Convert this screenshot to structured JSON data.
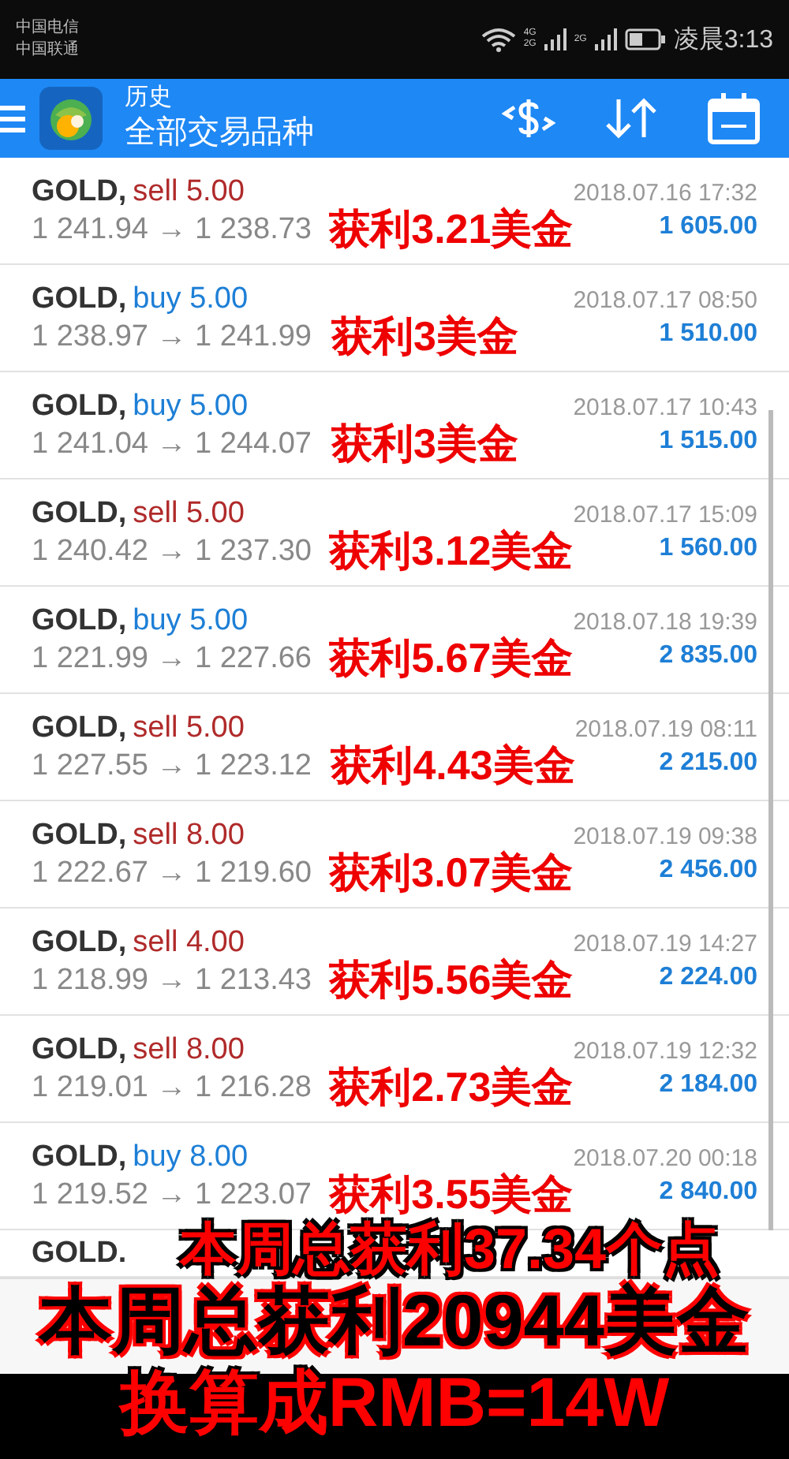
{
  "status_bar": {
    "carriers": [
      "中国电信",
      "中国联通"
    ],
    "network_labels": [
      "4G",
      "2G",
      "2G"
    ],
    "time": "凌晨3:13"
  },
  "app_bar": {
    "title": "历史",
    "subtitle": "全部交易品种"
  },
  "trades": [
    {
      "symbol": "GOLD,",
      "side": "sell",
      "lots": "5.00",
      "prices": "1 241.94 → 1 238.73",
      "time": "2018.07.16 17:32",
      "profit": "1 605.00",
      "note": "获利3.21美金"
    },
    {
      "symbol": "GOLD,",
      "side": "buy",
      "lots": "5.00",
      "prices": "1 238.97 → 1 241.99",
      "time": "2018.07.17 08:50",
      "profit": "1 510.00",
      "note": "获利3美金"
    },
    {
      "symbol": "GOLD,",
      "side": "buy",
      "lots": "5.00",
      "prices": "1 241.04 → 1 244.07",
      "time": "2018.07.17 10:43",
      "profit": "1 515.00",
      "note": "获利3美金"
    },
    {
      "symbol": "GOLD,",
      "side": "sell",
      "lots": "5.00",
      "prices": "1 240.42 → 1 237.30",
      "time": "2018.07.17 15:09",
      "profit": "1 560.00",
      "note": "获利3.12美金"
    },
    {
      "symbol": "GOLD,",
      "side": "buy",
      "lots": "5.00",
      "prices": "1 221.99 → 1 227.66",
      "time": "2018.07.18 19:39",
      "profit": "2 835.00",
      "note": "获利5.67美金"
    },
    {
      "symbol": "GOLD,",
      "side": "sell",
      "lots": "5.00",
      "prices": "1 227.55 → 1 223.12",
      "time": "2018.07.19 08:11",
      "profit": "2 215.00",
      "note": "获利4.43美金"
    },
    {
      "symbol": "GOLD,",
      "side": "sell",
      "lots": "8.00",
      "prices": "1 222.67 → 1 219.60",
      "time": "2018.07.19 09:38",
      "profit": "2 456.00",
      "note": "获利3.07美金"
    },
    {
      "symbol": "GOLD,",
      "side": "sell",
      "lots": "4.00",
      "prices": "1 218.99 → 1 213.43",
      "time": "2018.07.19 14:27",
      "profit": "2 224.00",
      "note": "获利5.56美金"
    },
    {
      "symbol": "GOLD,",
      "side": "sell",
      "lots": "8.00",
      "prices": "1 219.01 → 1 216.28",
      "time": "2018.07.19 12:32",
      "profit": "2 184.00",
      "note": "获利2.73美金"
    },
    {
      "symbol": "GOLD,",
      "side": "buy",
      "lots": "8.00",
      "prices": "1 219.52 → 1 223.07",
      "time": "2018.07.20 00:18",
      "profit": "2 840.00",
      "note": "获利3.55美金"
    }
  ],
  "partial_row": {
    "symbol": "GOLD."
  },
  "banners": [
    {
      "kind": "red",
      "text": "本周总获利37.34个点"
    },
    {
      "kind": "black",
      "text": "本周总获利20944美金"
    },
    {
      "kind": "red",
      "text": "换算成RMB=14W"
    }
  ]
}
